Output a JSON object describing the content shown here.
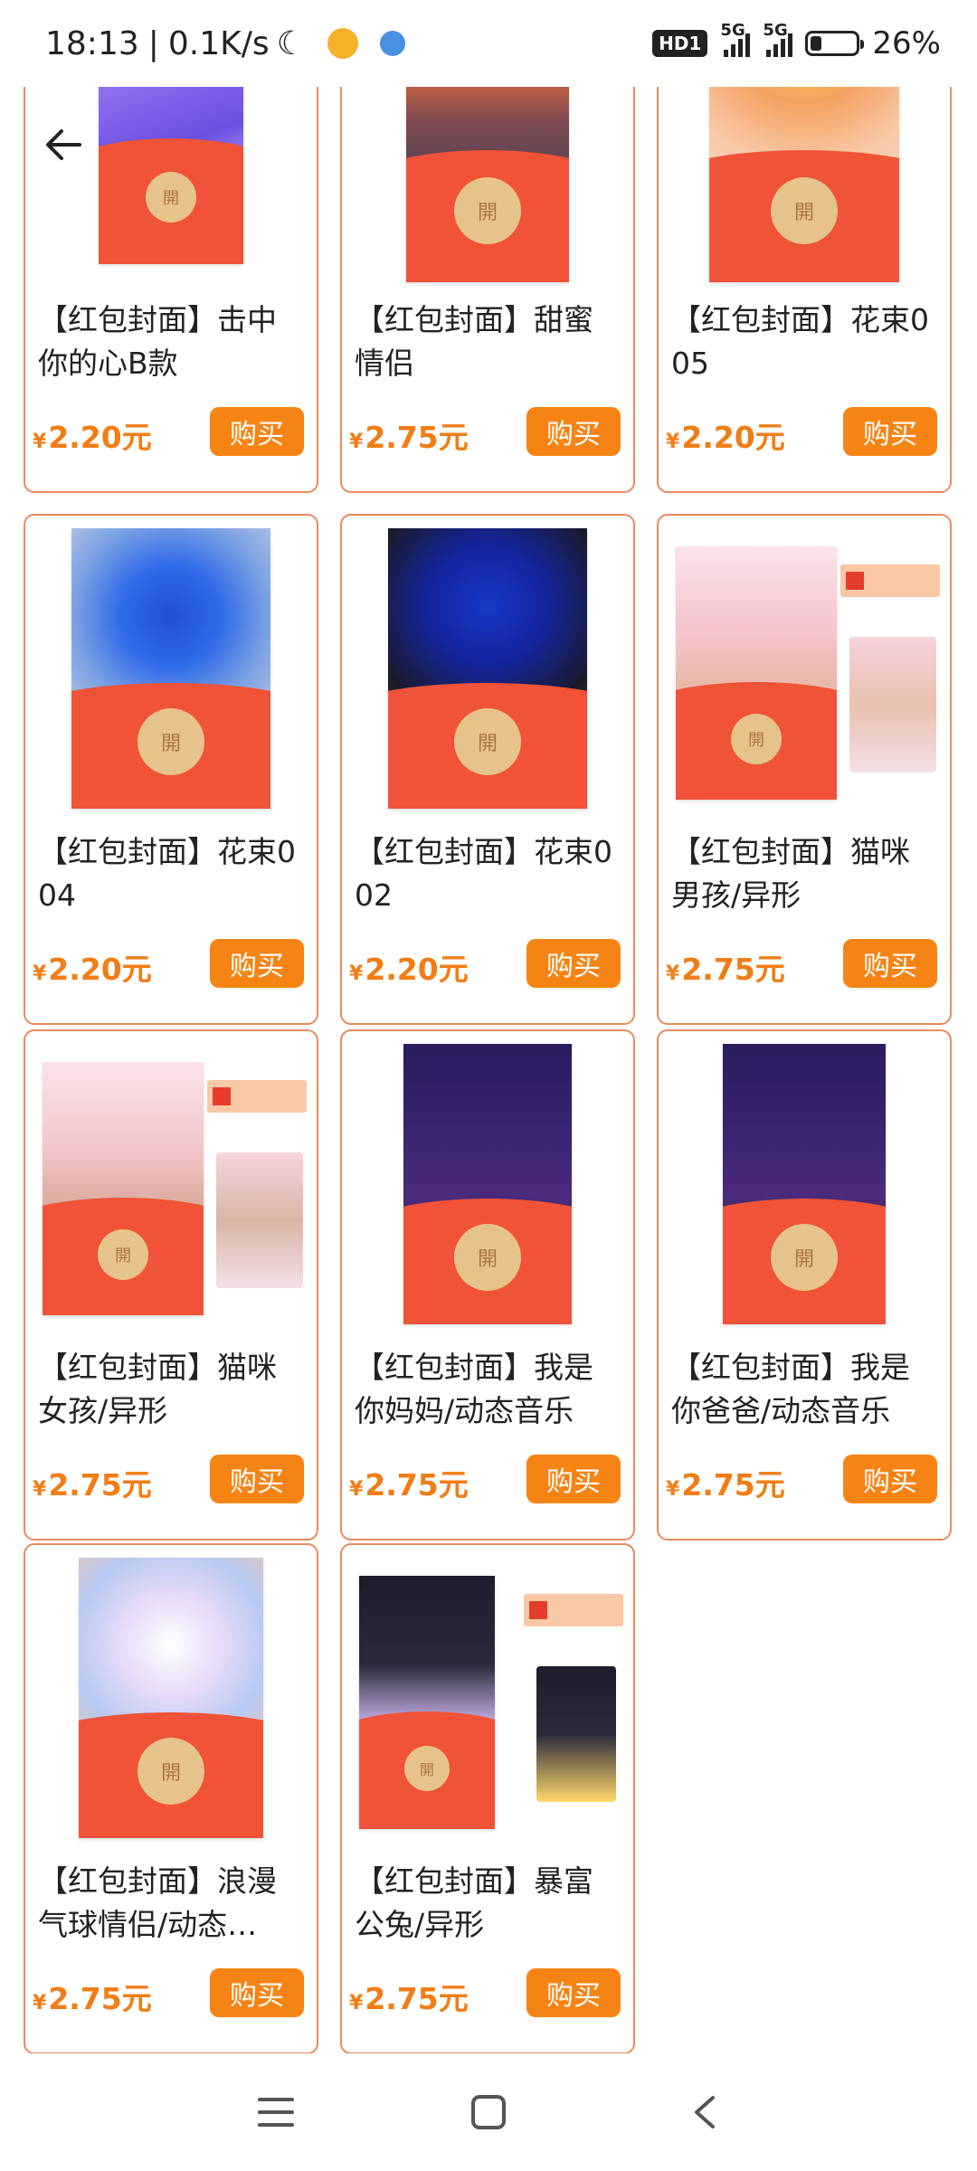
{
  "status_bar": {
    "time": "18:13",
    "separator": "|",
    "speed": "0.1K/s",
    "moon_icon": "moon-icon",
    "hd_badge": "HD1",
    "net1": "5G",
    "net2": "5G",
    "battery_percent": "26%",
    "battery_level": 0.26
  },
  "back_label": "back-arrow-icon",
  "products": [
    {
      "title": "【红包封面】击中你的心B款",
      "price_symbol": "¥",
      "price": "2.20元",
      "buy": "购买",
      "open": "開"
    },
    {
      "title": "【红包封面】甜蜜情侣",
      "price_symbol": "¥",
      "price": "2.75元",
      "buy": "购买",
      "open": "開"
    },
    {
      "title": "【红包封面】花束005",
      "price_symbol": "¥",
      "price": "2.20元",
      "buy": "购买",
      "open": "開"
    },
    {
      "title": "【红包封面】花束004",
      "price_symbol": "¥",
      "price": "2.20元",
      "buy": "购买",
      "open": "開"
    },
    {
      "title": "【红包封面】花束002",
      "price_symbol": "¥",
      "price": "2.20元",
      "buy": "购买",
      "open": "開"
    },
    {
      "title": "【红包封面】猫咪男孩/异形",
      "price_symbol": "¥",
      "price": "2.75元",
      "buy": "购买",
      "open": "開"
    },
    {
      "title": "【红包封面】猫咪女孩/异形",
      "price_symbol": "¥",
      "price": "2.75元",
      "buy": "购买",
      "open": "開"
    },
    {
      "title": "【红包封面】我是你妈妈/动态音乐",
      "price_symbol": "¥",
      "price": "2.75元",
      "buy": "购买",
      "open": "開"
    },
    {
      "title": "【红包封面】我是你爸爸/动态音乐",
      "price_symbol": "¥",
      "price": "2.75元",
      "buy": "购买",
      "open": "開"
    },
    {
      "title": "【红包封面】浪漫气球情侣/动态…",
      "price_symbol": "¥",
      "price": "2.75元",
      "buy": "购买",
      "open": "開"
    },
    {
      "title": "【红包封面】暴富公兔/异形",
      "price_symbol": "¥",
      "price": "2.75元",
      "buy": "购买",
      "open": "開"
    }
  ],
  "colors": {
    "accent_orange": "#f68415",
    "price_orange": "#f07d16",
    "card_border": "#e98a5e",
    "envelope_red": "#f05337",
    "open_button_gold": "#e6c38a"
  },
  "nav": {
    "menu_icon": "menu-icon",
    "home_icon": "home-square-icon",
    "back_icon": "back-chevron-icon"
  }
}
